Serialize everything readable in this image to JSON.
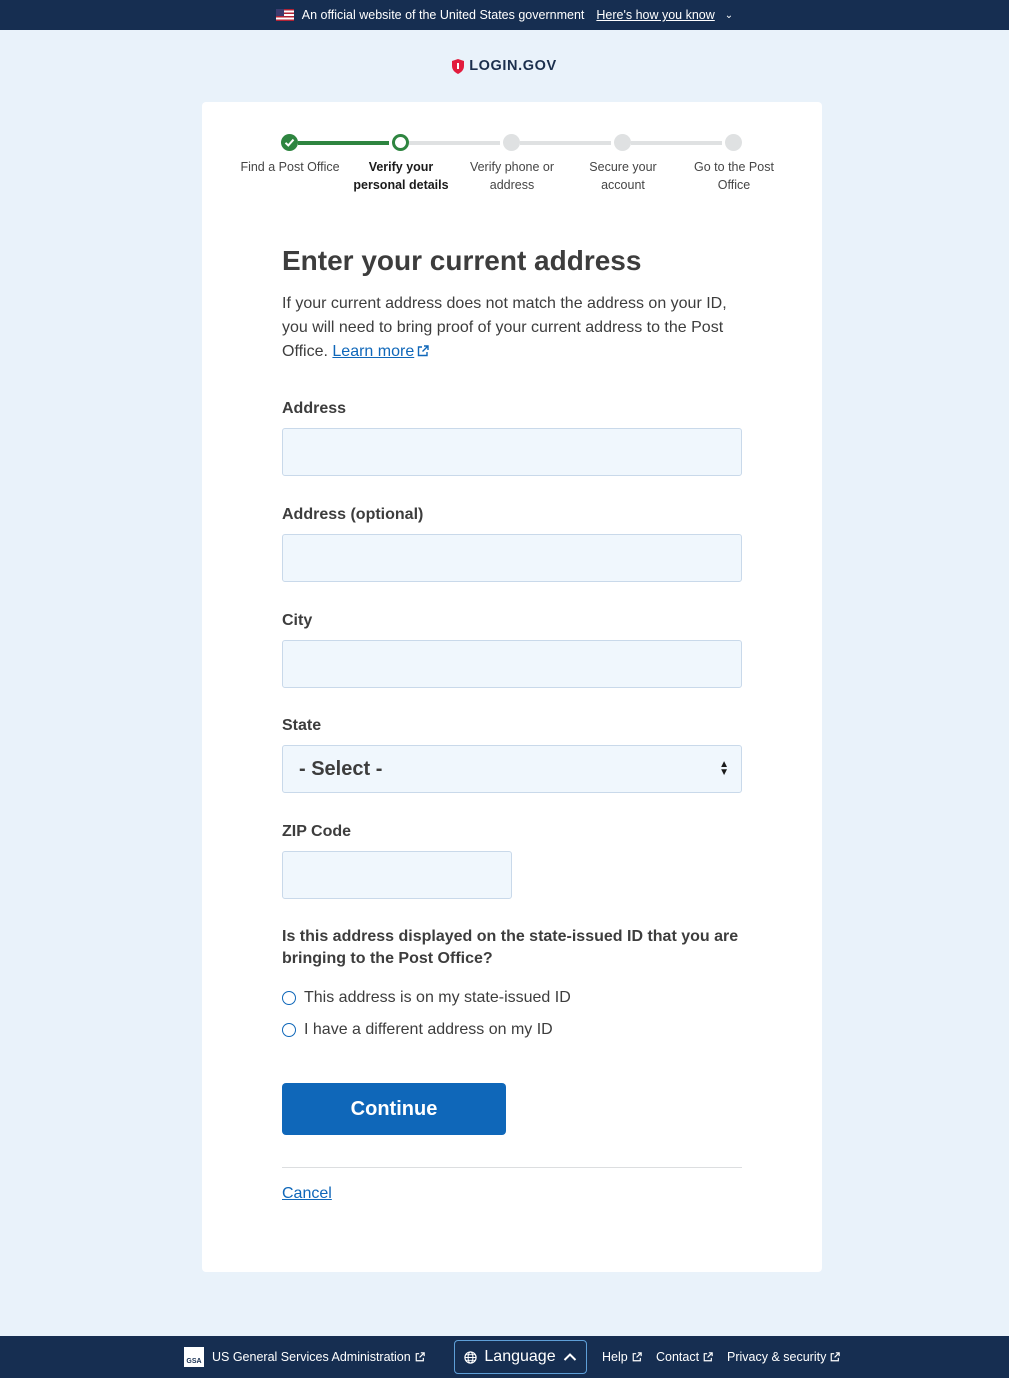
{
  "banner": {
    "text": "An official website of the United States government",
    "link": "Here's how you know"
  },
  "logo": {
    "text": "LOGIN.GOV"
  },
  "steps": [
    {
      "label": "Find a Post Office",
      "status": "complete"
    },
    {
      "label": "Verify your personal details",
      "status": "current"
    },
    {
      "label": "Verify phone or address",
      "status": "incomplete"
    },
    {
      "label": "Secure your account",
      "status": "incomplete"
    },
    {
      "label": "Go to the Post Office",
      "status": "incomplete"
    }
  ],
  "form": {
    "title": "Enter your current address",
    "intro": "If your current address does not match the address on your ID, you will need to bring proof of your current address to the Post Office.",
    "learn_more": "Learn more",
    "fields": {
      "address1": {
        "label": "Address",
        "value": ""
      },
      "address2": {
        "label": "Address (optional)",
        "value": ""
      },
      "city": {
        "label": "City",
        "value": ""
      },
      "state": {
        "label": "State",
        "selected": "- Select -"
      },
      "zip": {
        "label": "ZIP Code",
        "value": ""
      }
    },
    "question": "Is this address displayed on the state-issued ID that you are bringing to the Post Office?",
    "options": [
      "This address is on my state-issued ID",
      "I have a different address on my ID"
    ],
    "continue_label": "Continue",
    "cancel_label": "Cancel"
  },
  "footer": {
    "gsa": "US General Services Administration",
    "gsa_logo": "GSA",
    "language": "Language",
    "help": "Help",
    "contact": "Contact",
    "privacy": "Privacy & security"
  },
  "colors": {
    "primary": "#0f67b9",
    "success": "#2e8540",
    "navy": "#162e51",
    "page_bg": "#e9f2fa"
  }
}
